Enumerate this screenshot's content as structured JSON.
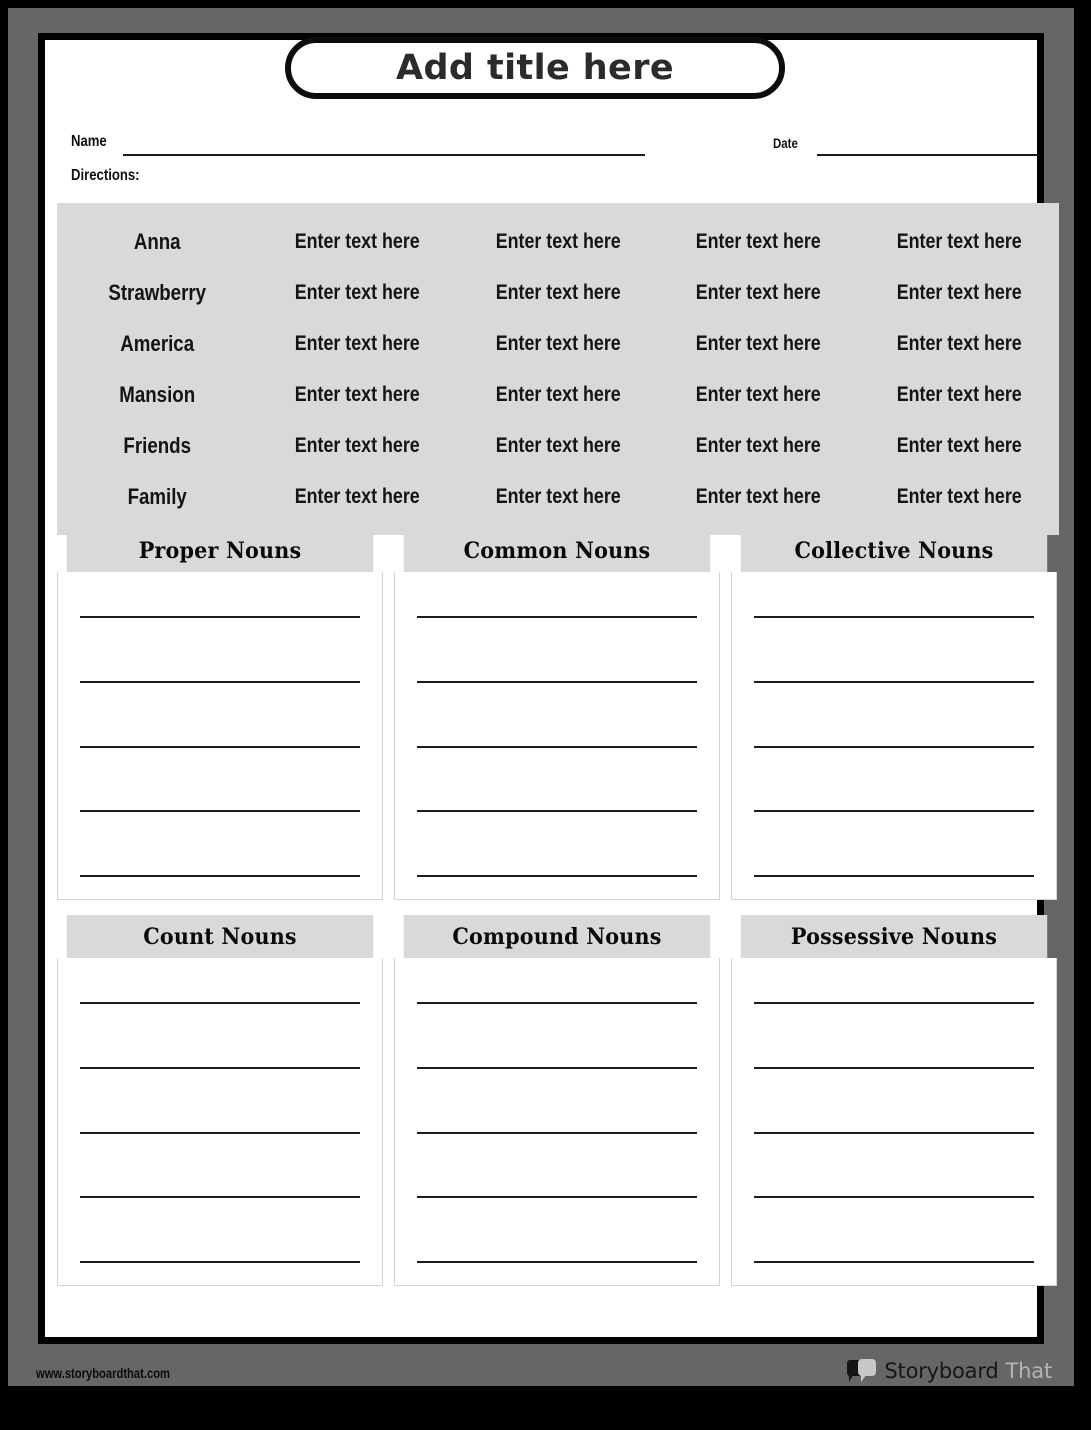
{
  "title": "Add title here",
  "header": {
    "name_label": "Name",
    "date_label": "Date",
    "directions_label": "Directions:"
  },
  "word_table": {
    "placeholder": "Enter text here",
    "rows": [
      {
        "word": "Anna",
        "c1": "Enter text here",
        "c2": "Enter text here",
        "c3": "Enter text here",
        "c4": "Enter text here"
      },
      {
        "word": "Strawberry",
        "c1": "Enter text here",
        "c2": "Enter text here",
        "c3": "Enter text here",
        "c4": "Enter text here"
      },
      {
        "word": "America",
        "c1": "Enter text here",
        "c2": "Enter text here",
        "c3": "Enter text here",
        "c4": "Enter text here"
      },
      {
        "word": "Mansion",
        "c1": "Enter text here",
        "c2": "Enter text here",
        "c3": "Enter text here",
        "c4": "Enter text here"
      },
      {
        "word": "Friends",
        "c1": "Enter text here",
        "c2": "Enter text here",
        "c3": "Enter text here",
        "c4": "Enter text here"
      },
      {
        "word": "Family",
        "c1": "Enter text here",
        "c2": "Enter text here",
        "c3": "Enter text here",
        "c4": "Enter text here"
      }
    ]
  },
  "categories": [
    {
      "title": "Proper Nouns"
    },
    {
      "title": "Common Nouns"
    },
    {
      "title": "Collective Nouns"
    },
    {
      "title": "Count Nouns"
    },
    {
      "title": "Compound Nouns"
    },
    {
      "title": "Possessive Nouns"
    }
  ],
  "lines_per_category": 5,
  "footer": {
    "url": "www.storyboardthat.com",
    "brand_main": "Storyboard",
    "brand_sub": "That"
  },
  "colors": {
    "frame_gray": "#666666",
    "band_gray": "#d9d9d9",
    "ink": "#141414",
    "brand_sub_gray": "#b4b4b4"
  }
}
